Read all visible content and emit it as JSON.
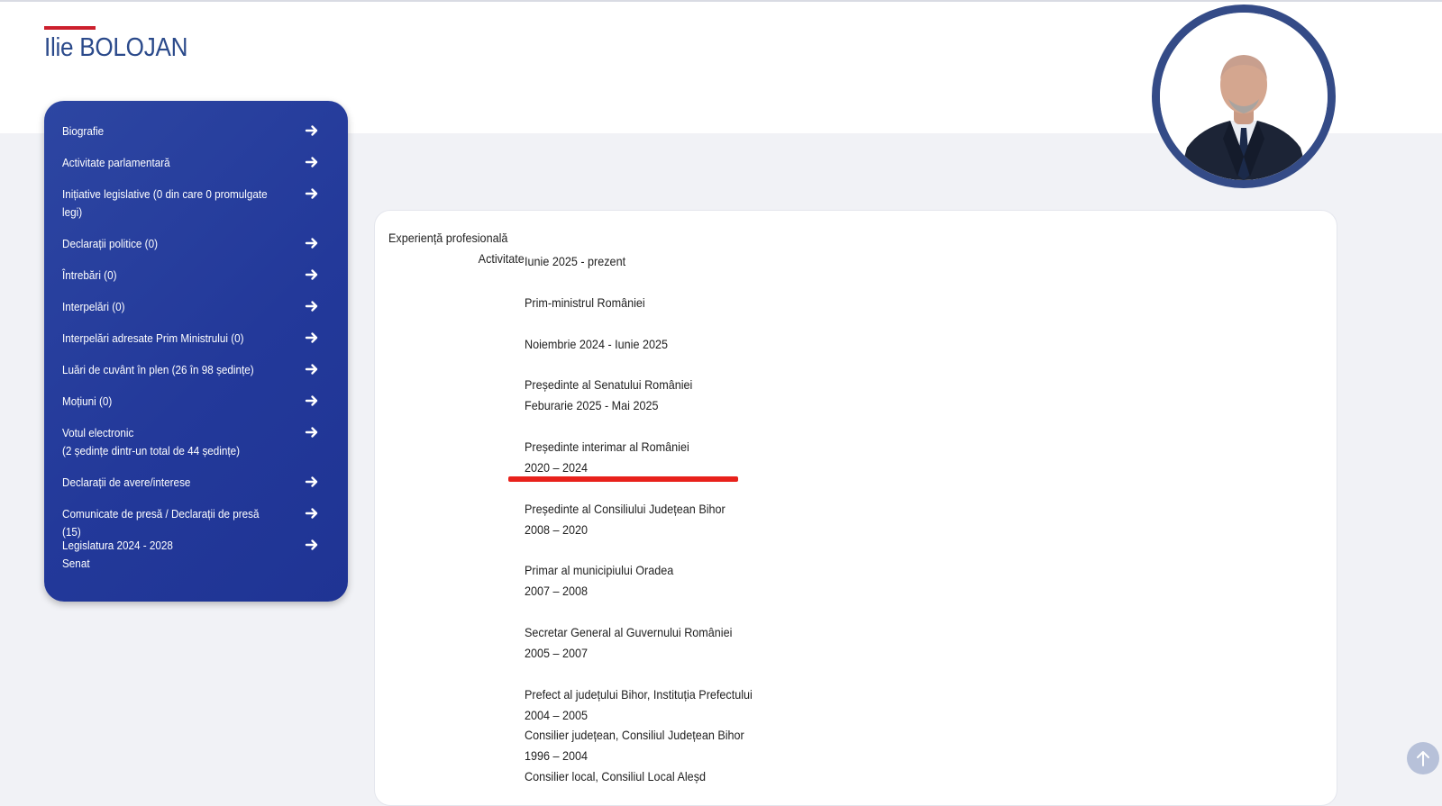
{
  "header": {
    "title": "Ilie BOLOJAN",
    "accent_color": "#cc1f2d",
    "title_color": "#2b4a8b"
  },
  "sidebar": {
    "background_color": "#2a42a0",
    "arrow_icon": "arrow-right-icon",
    "items": [
      {
        "label": "Biografie"
      },
      {
        "label": "Activitate parlamentară"
      },
      {
        "label": "Inițiative legislative (0 din care 0 promulgate legi)"
      },
      {
        "label": "Declarații politice (0)"
      },
      {
        "label": "Întrebări (0)"
      },
      {
        "label": "Interpelări (0)"
      },
      {
        "label": "Interpelări adresate Prim Ministrului (0)"
      },
      {
        "label": "Luări de cuvânt în plen (26 în 98 ședințe)"
      },
      {
        "label": "Moțiuni (0)"
      },
      {
        "label": "Votul electronic\n(2 ședințe dintr-un total de 44 ședințe)"
      },
      {
        "label": "Declarații de avere/interese"
      },
      {
        "label": "Comunicate de presă / Declarații de presă (15)"
      },
      {
        "label": "Legislatura 2024 - 2028\nSenat"
      }
    ]
  },
  "content": {
    "section_label": "Experiență profesională",
    "row_label": "Activitate",
    "lines": [
      "Iunie 2025 - prezent",
      "",
      "Prim-ministrul României",
      "",
      "Noiembrie 2024 - Iunie 2025",
      "",
      "Președinte al Senatului României",
      "Feburarie 2025 - Mai 2025",
      "",
      "Președinte interimar al României",
      "2020 – 2024",
      "",
      "Președinte al Consiliului Județean Bihor",
      "2008 – 2020",
      "",
      "Primar al municipiului Oradea",
      "2007 – 2008",
      "",
      "Secretar General al Guvernului României",
      "2005 – 2007",
      "",
      "Prefect al județului Bihor, Instituția Prefectului",
      "2004 – 2005",
      "Consilier județean, Consiliul Județean Bihor",
      "1996 – 2004",
      "Consilier local, Consiliul Local Aleșd"
    ],
    "highlight_color": "#e8211b"
  },
  "avatar": {
    "icon": "portrait-photo",
    "border_color": "#344b87"
  },
  "back_to_top": {
    "icon": "arrow-up-icon"
  }
}
